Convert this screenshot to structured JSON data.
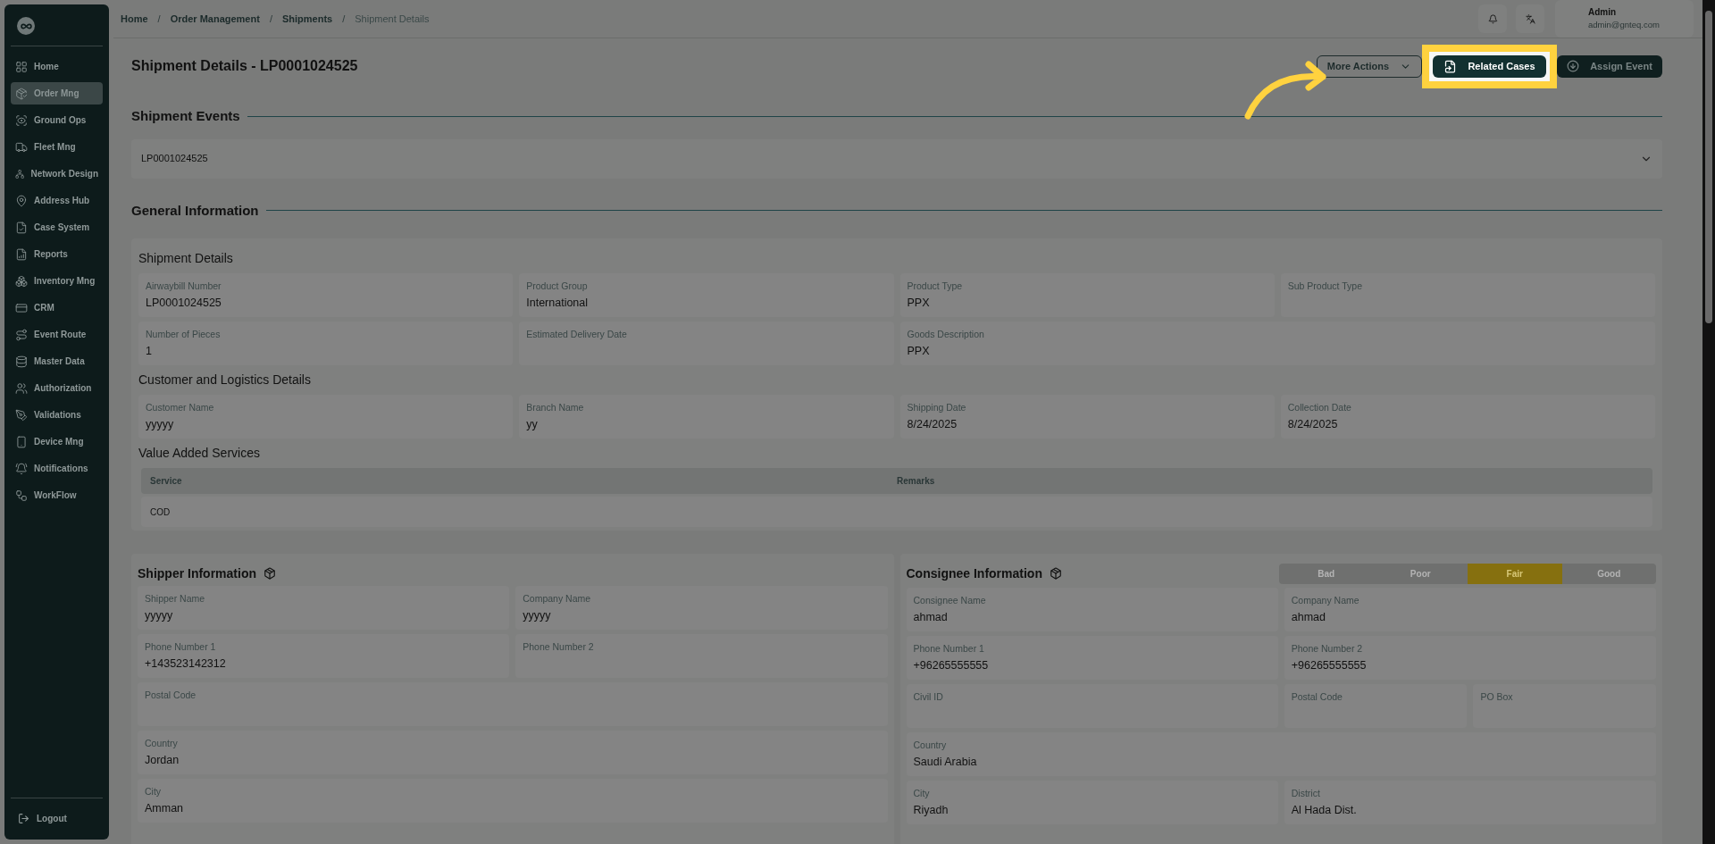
{
  "sidebar": {
    "items": [
      {
        "label": "Home",
        "selected": false
      },
      {
        "label": "Order Mng",
        "selected": true
      },
      {
        "label": "Ground Ops",
        "selected": false
      },
      {
        "label": "Fleet Mng",
        "selected": false
      },
      {
        "label": "Network Design",
        "selected": false
      },
      {
        "label": "Address Hub",
        "selected": false
      },
      {
        "label": "Case System",
        "selected": false
      },
      {
        "label": "Reports",
        "selected": false
      },
      {
        "label": "Inventory Mng",
        "selected": false
      },
      {
        "label": "CRM",
        "selected": false
      },
      {
        "label": "Event Route",
        "selected": false
      },
      {
        "label": "Master Data",
        "selected": false
      },
      {
        "label": "Authorization",
        "selected": false
      },
      {
        "label": "Validations",
        "selected": false
      },
      {
        "label": "Device Mng",
        "selected": false
      },
      {
        "label": "Notifications",
        "selected": false
      },
      {
        "label": "WorkFlow",
        "selected": false
      }
    ],
    "logout": "Logout"
  },
  "header": {
    "breadcrumb": [
      {
        "label": "Home",
        "current": false
      },
      {
        "label": "Order Management",
        "current": false
      },
      {
        "label": "Shipments",
        "current": false
      },
      {
        "label": "Shipment Details",
        "current": true
      }
    ],
    "separator": "/",
    "user": {
      "name": "Admin",
      "email": "admin@gnteq.com"
    }
  },
  "page": {
    "title": "Shipment Details - LP0001024525",
    "actions": [
      {
        "label": "More Actions",
        "kind": "outline",
        "highlighted": false
      },
      {
        "label": "Related Cases",
        "kind": "primary",
        "highlighted": true
      },
      {
        "label": "Assign Event",
        "kind": "dark",
        "highlighted": false
      }
    ]
  },
  "shipment_events": {
    "title": "Shipment Events",
    "items": [
      {
        "label": "LP0001024525",
        "expanded": false
      }
    ]
  },
  "general_information": {
    "title": "General Information",
    "sections": [
      {
        "title": "Shipment Details",
        "rows": [
          [
            {
              "label": "Airwaybill Number",
              "value": "LP0001024525"
            },
            {
              "label": "Product Group",
              "value": "International"
            },
            {
              "label": "Product Type",
              "value": "PPX"
            },
            {
              "label": "Sub Product Type"
            }
          ],
          [
            {
              "label": "Number of Pieces",
              "value": "1"
            },
            {
              "label": "Estimated Delivery Date"
            },
            {
              "label": "Goods Description",
              "value": "PPX"
            }
          ]
        ]
      },
      {
        "title": "Customer and Logistics Details",
        "rows": [
          [
            {
              "label": "Customer Name",
              "value": "yyyyy"
            },
            {
              "label": "Branch Name",
              "value": "yy"
            },
            {
              "label": "Shipping Date",
              "value": "8/24/2025"
            },
            {
              "label": "Collection Date",
              "value": "8/24/2025"
            }
          ]
        ]
      }
    ],
    "value_added_services": {
      "title": "Value Added Services",
      "columns": [
        "Service",
        "Remarks"
      ],
      "rows": [
        [
          "COD"
        ]
      ]
    }
  },
  "shipper": {
    "title": "Shipper Information",
    "rows": [
      [
        {
          "label": "Shipper Name",
          "value": "yyyyy"
        },
        {
          "label": "Company Name",
          "value": "yyyyy"
        }
      ],
      [
        {
          "label": "Phone Number 1",
          "value": "+143523142312"
        },
        {
          "label": "Phone Number 2"
        }
      ],
      [
        {
          "label": "Postal Code"
        }
      ],
      [
        {
          "label": "Country",
          "value": "Jordan"
        }
      ],
      [
        {
          "label": "City",
          "value": "Amman"
        }
      ]
    ]
  },
  "consignee": {
    "title": "Consignee Information",
    "rating": [
      {
        "label": "Bad",
        "selected": false
      },
      {
        "label": "Poor",
        "selected": false
      },
      {
        "label": "Fair",
        "selected": true
      },
      {
        "label": "Good",
        "selected": false
      }
    ],
    "rows": [
      [
        {
          "label": "Consignee Name",
          "value": "ahmad"
        },
        {
          "label": "Company Name",
          "value": "ahmad"
        }
      ],
      [
        {
          "label": "Phone Number 1",
          "value": "+96265555555"
        },
        {
          "label": "Phone Number 2",
          "value": "+96265555555"
        }
      ],
      [
        {
          "label": "Civil ID"
        },
        {
          "label": "Postal Code"
        },
        {
          "label": "PO Box"
        }
      ],
      [
        {
          "label": "Country",
          "value": "Saudi Arabia"
        }
      ],
      [
        {
          "label": "City",
          "value": "Riyadh"
        },
        {
          "label": "District",
          "value": "Al Hada Dist."
        }
      ]
    ]
  }
}
